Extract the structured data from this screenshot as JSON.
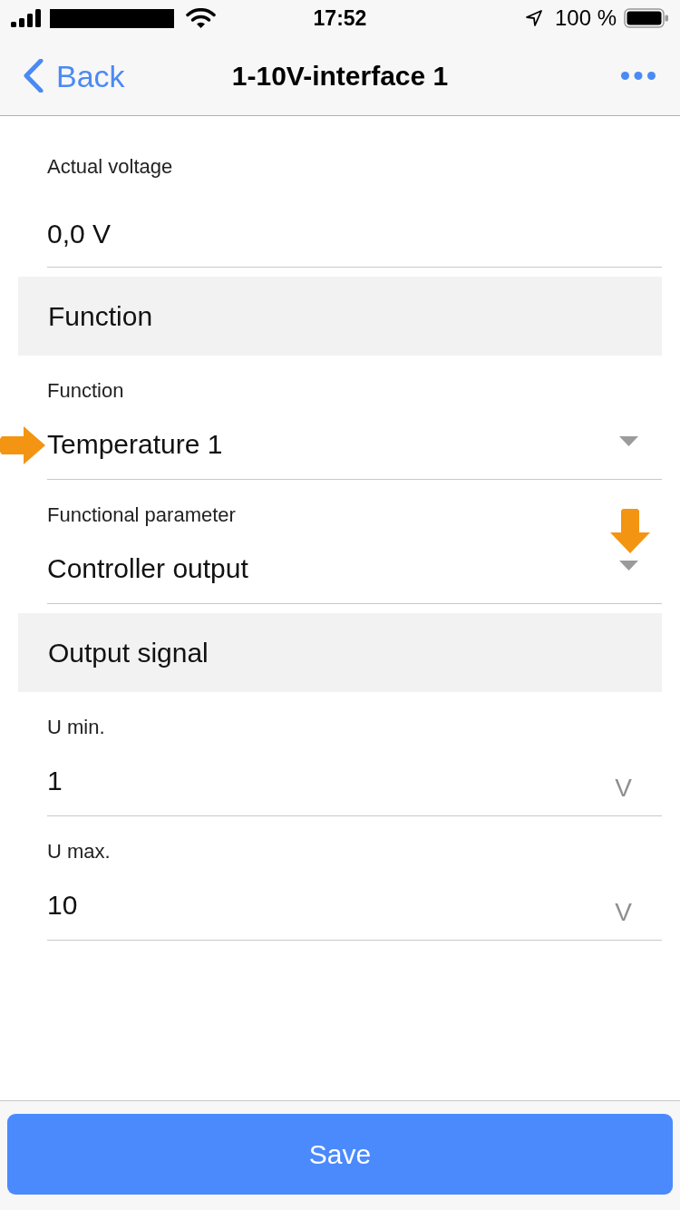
{
  "status_bar": {
    "time": "17:52",
    "battery_percent": "100 %"
  },
  "nav": {
    "back_label": "Back",
    "title": "1-10V-interface 1"
  },
  "items": [
    {
      "kind": "readout",
      "label": "Actual voltage",
      "value": "0,0 V"
    },
    {
      "kind": "header",
      "title": "Function"
    },
    {
      "kind": "dropdown",
      "label": "Function",
      "value": "Temperature 1",
      "annotation": {
        "kind": "rightarrow"
      }
    },
    {
      "kind": "dropdown",
      "label": "Functional parameter",
      "value": "Controller output",
      "annotation": {
        "kind": "downarrow"
      }
    },
    {
      "kind": "header",
      "title": "Output signal"
    },
    {
      "kind": "number",
      "label": "U min.",
      "value": "1",
      "unit": "V"
    },
    {
      "kind": "number",
      "label": "U max.",
      "value": "10",
      "unit": "V"
    }
  ],
  "save_button": {
    "label": "Save"
  }
}
